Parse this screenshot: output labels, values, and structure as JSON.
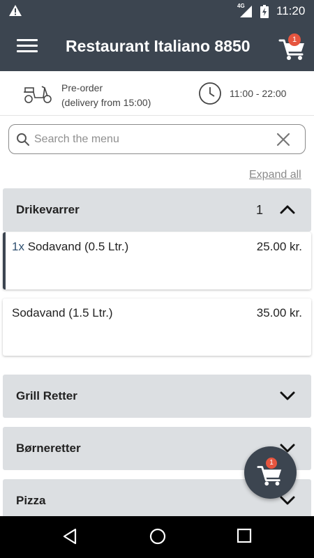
{
  "status_bar": {
    "network": "4G",
    "time": "11:20",
    "icons": [
      "warning-icon",
      "signal-icon",
      "battery-charging-icon"
    ]
  },
  "app_bar": {
    "title": "Restaurant Italiano 8850",
    "cart_count": "1",
    "icons": [
      "menu-icon",
      "cart-icon"
    ]
  },
  "info": {
    "preorder_line1": "Pre-order",
    "preorder_line2": "(delivery from 15:00)",
    "hours": "11:00 - 22:00",
    "icons": [
      "scooter-icon",
      "clock-icon"
    ]
  },
  "search": {
    "placeholder": "Search the menu",
    "value": "",
    "icons": [
      "search-icon",
      "clear-icon"
    ]
  },
  "expand_all": "Expand all",
  "categories": [
    {
      "name": "Drikevarrer",
      "count": "1",
      "expanded": true,
      "items": [
        {
          "qty": "1x",
          "name": "Sodavand (0.5 Ltr.)",
          "price": "25.00 kr."
        },
        {
          "qty": "",
          "name": "Sodavand (1.5 Ltr.)",
          "price": "35.00 kr."
        }
      ]
    },
    {
      "name": "Grill Retter",
      "expanded": false
    },
    {
      "name": "Børneretter",
      "expanded": false
    },
    {
      "name": "Pizza",
      "expanded": false
    }
  ],
  "floating_cart": {
    "count": "1"
  },
  "nav_bar": {
    "icons": [
      "back-icon",
      "home-icon",
      "recents-icon"
    ]
  },
  "colors": {
    "header": "#3c4550",
    "category_bg": "#dcdfe2",
    "badge": "#e6553f",
    "quantity_text": "#2f4f6f"
  }
}
